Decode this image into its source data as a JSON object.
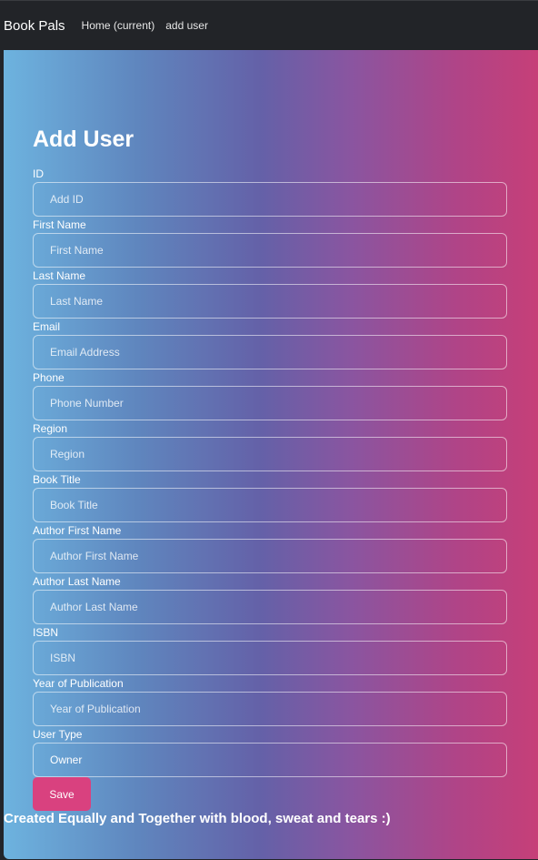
{
  "navbar": {
    "brand": "Book Pals",
    "links": [
      {
        "label": "Home (current)"
      },
      {
        "label": "add user"
      }
    ]
  },
  "main": {
    "title": "Add User",
    "fields": [
      {
        "label": "ID",
        "placeholder": "Add ID",
        "value": ""
      },
      {
        "label": "First Name",
        "placeholder": "First Name",
        "value": ""
      },
      {
        "label": "Last Name",
        "placeholder": "Last Name",
        "value": ""
      },
      {
        "label": "Email",
        "placeholder": "Email Address",
        "value": ""
      },
      {
        "label": "Phone",
        "placeholder": "Phone Number",
        "value": ""
      },
      {
        "label": "Region",
        "placeholder": "Region",
        "value": ""
      },
      {
        "label": "Book Title",
        "placeholder": "Book Title",
        "value": ""
      },
      {
        "label": "Author First Name",
        "placeholder": "Author First Name",
        "value": ""
      },
      {
        "label": "Author Last Name",
        "placeholder": "Author Last Name",
        "value": ""
      },
      {
        "label": "ISBN",
        "placeholder": "ISBN",
        "value": ""
      },
      {
        "label": "Year of Publication",
        "placeholder": "Year of Publication",
        "value": ""
      },
      {
        "label": "User Type",
        "placeholder": "",
        "value": "Owner"
      }
    ],
    "save_label": "Save",
    "footer_text": "Created Equally and Together with blood, sweat and tears :)"
  },
  "colors": {
    "navbar_bg": "#222428",
    "gradient_start": "#6db3df",
    "gradient_mid": "#6461a8",
    "gradient_end": "#c63f78",
    "save_button": "#d9417f"
  }
}
